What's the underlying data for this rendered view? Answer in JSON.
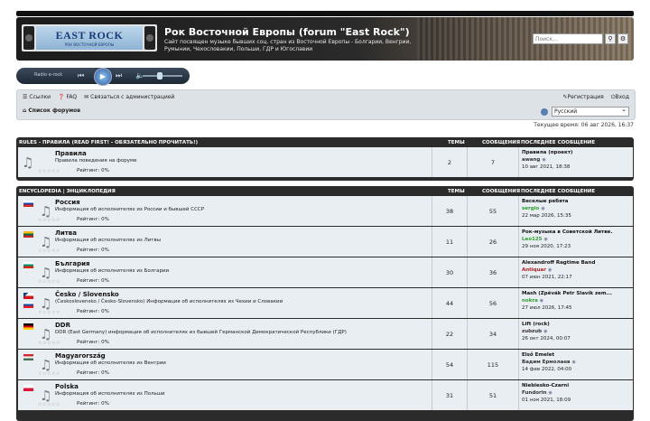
{
  "header": {
    "logo_main": "EAST ROCK",
    "logo_sub": "РОК ВОСТОЧНОЙ ЕВРОПЫ",
    "title": "Рок Восточной Европы (forum \"East Rock\")",
    "description": "Сайт посвящен музыке бывших соц. стран из Восточной Европы - Болгарии, Венгрии, Румынии, Чехословакии, Польши, ГДР и Югославии",
    "search_placeholder": "Поиск..."
  },
  "radio": {
    "label": "Radio e-rock"
  },
  "nav": {
    "links": "Ссылки",
    "faq": "FAQ",
    "contact": "Связаться с администрацией",
    "register": "Регистрация",
    "login": "Вход",
    "forum_index": "Список форумов",
    "language": "Русский"
  },
  "current_time": "Текущее время: 06 авг 2026, 16:37",
  "columns": {
    "topics": "ТЕМЫ",
    "posts": "СООБЩЕНИЯ",
    "last_post": "ПОСЛЕДНЕЕ СООБЩЕНИЕ"
  },
  "rules_block": {
    "title": "RULES - ПРАВИЛА (READ FIRST! - ОБЯЗАТЕЛЬНО ПРОЧИТАТЬ!)",
    "rows": [
      {
        "name": "Правила",
        "desc": "Правила поведения на форуме",
        "rating": "Рейтинг: 0%",
        "topics": "2",
        "posts": "7",
        "lp_title": "Правила (проект)",
        "lp_user": "awang",
        "lp_user_color": "#333333",
        "lp_date": "10 авг 2021, 18:38"
      }
    ]
  },
  "enc_block": {
    "title": "ENCYCLOPEDIA | ЭНЦИКЛОПЕДИЯ",
    "rows": [
      {
        "name": "Россия",
        "desc": "Информация об исполнителях из России и бывшей СССР",
        "rating": "Рейтинг: 0%",
        "topics": "38",
        "posts": "55",
        "lp_title": "Веселые ребята",
        "lp_user": "sergio",
        "lp_user_color": "#2a9d2a",
        "lp_date": "22 мар 2026, 15:35",
        "flag": "ru"
      },
      {
        "name": "Литва",
        "desc": "Информация об исполнителях из Литвы",
        "rating": "Рейтинг: 0%",
        "topics": "11",
        "posts": "26",
        "lp_title": "Рок-музыка в Советской Литве.",
        "lp_user": "Leo125",
        "lp_user_color": "#2a9d2a",
        "lp_date": "29 ноя 2020, 17:23",
        "flag": "lt"
      },
      {
        "name": "България",
        "desc": "Информация об исполнителях из Болгарии",
        "rating": "Рейтинг: 0%",
        "topics": "30",
        "posts": "36",
        "lp_title": "Alexandroff Ragtime Band",
        "lp_user": "Antiquar",
        "lp_user_color": "#b22222",
        "lp_date": "07 июн 2021, 22:17",
        "flag": "bg"
      },
      {
        "name": "Česko / Slovensko",
        "desc": "(Československo / Česko-Slovensko) Информация об исполнителях из Чехии и Словакии",
        "rating": "Рейтинг: 0%",
        "topics": "44",
        "posts": "56",
        "lp_title": "Mash (Zpěvák Petr Slavík zem...",
        "lp_user": "nokra",
        "lp_user_color": "#2a9d2a",
        "lp_date": "27 июл 2026, 17:45",
        "flag": "cz",
        "flag2": "sk"
      },
      {
        "name": "DDR",
        "desc": "DDR (East Germany) информация об исполнителях из бывшей Германской Демократической Республики (ГДР)",
        "rating": "Рейтинг: 0%",
        "topics": "22",
        "posts": "34",
        "lp_title": "Lift (rock)",
        "lp_user": "zubzub",
        "lp_user_color": "#333333",
        "lp_date": "26 окт 2024, 00:07",
        "flag": "de"
      },
      {
        "name": "Magyarország",
        "desc": "Информация об исполнителях из Венгрии",
        "rating": "Рейтинг: 0%",
        "topics": "54",
        "posts": "115",
        "lp_title": "Első Emelet",
        "lp_user": "Вадим Ермолаев",
        "lp_user_color": "#333333",
        "lp_date": "14 фев 2022, 04:00",
        "flag": "hu"
      },
      {
        "name": "Polska",
        "desc": "Информация об исполнителях из Польши",
        "rating": "Рейтинг: 0%",
        "topics": "31",
        "posts": "51",
        "lp_title": "Niebiesko-Czarni",
        "lp_user": "Fundorin",
        "lp_user_color": "#333333",
        "lp_date": "01 ноя 2021, 18:09",
        "flag": "pl"
      }
    ]
  }
}
